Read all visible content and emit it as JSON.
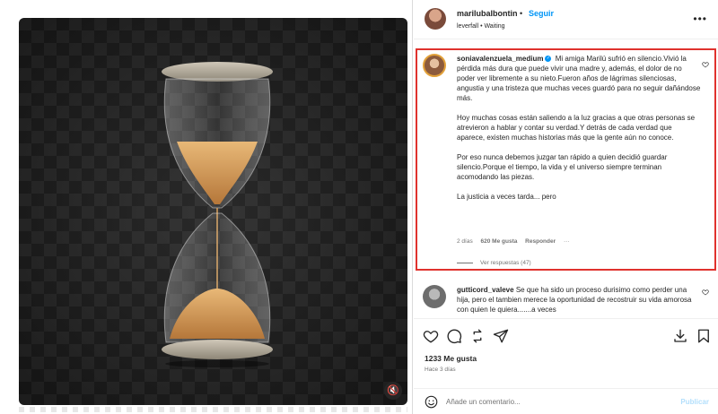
{
  "header": {
    "username": "marilubalbontin",
    "separator": "•",
    "follow_label": "Seguir",
    "audio": "leverfall • Waiting",
    "more_icon": "more-horizontal-icon"
  },
  "comments": [
    {
      "username": "soniavalenzuela_medium",
      "verified": true,
      "paragraphs": [
        "Mi amiga Marilú sufrió en silencio.Vivió la pérdida más dura que puede vivir una madre y, además, el dolor de no poder ver libremente a su nieto.Fueron años de lágrimas silenciosas, angustia y una tristeza que muchas veces guardó para no seguir dañándose más.",
        "Hoy muchas cosas están saliendo a la luz gracias a que otras personas se atrevieron a hablar y contar su verdad.Y detrás de cada verdad que aparece, existen muchas historias más que la gente aún no conoce.",
        "Por eso nunca debemos juzgar tan rápido a quien decidió guardar silencio.Porque el tiempo, la vida y el universo siempre terminan acomodando las piezas.",
        "La justicia a veces tarda... pero"
      ],
      "time": "2 días",
      "likes": "620 Me gusta",
      "reply_label": "Responder",
      "more_label": "···",
      "view_replies": "Ver respuestas (47)",
      "highlight_color": "#e0322d"
    },
    {
      "username": "gutticord_valeve",
      "text": "Se que ha sido un proceso durisimo como perder una hija, pero el tambien merece la oportunidad de recostruir su vida amorosa con quien le quiera.......a veces"
    }
  ],
  "actions": {
    "icons": [
      "heart-icon",
      "comment-icon",
      "repost-icon",
      "share-icon",
      "download-icon",
      "bookmark-icon"
    ],
    "likes": "1233 Me gusta",
    "time": "Hace 3 días"
  },
  "comment_box": {
    "placeholder": "Añade un comentario...",
    "publish_label": "Publicar"
  },
  "media": {
    "subject": "hourglass-image",
    "mute_icon": "muted-speaker-icon"
  },
  "colors": {
    "accent": "#0095f6",
    "muted_text": "#737373",
    "sand": "#d9a25f"
  }
}
